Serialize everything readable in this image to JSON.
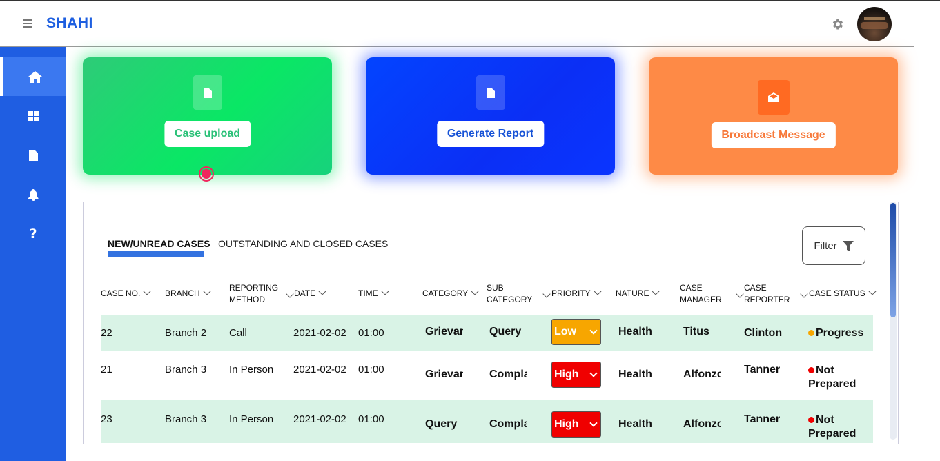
{
  "app": {
    "brand": "SHAHI"
  },
  "colors": {
    "primary": "#1f5ee2",
    "green": "#0ae765",
    "blue": "#0344ff",
    "orange": "#fe8a46",
    "low": "#f7a600",
    "high": "#f00000",
    "row_shade": "#d9f3e6"
  },
  "sidebar": {
    "items": [
      {
        "icon": "home-icon"
      },
      {
        "icon": "dashboard-icon"
      },
      {
        "icon": "document-icon"
      },
      {
        "icon": "bell-icon"
      },
      {
        "icon": "help-icon"
      }
    ]
  },
  "cards": {
    "upload": {
      "label": "Case upload",
      "icon": "file-icon"
    },
    "report": {
      "label": "Generate Report",
      "icon": "file-icon"
    },
    "broadcast": {
      "label": "Broadcast Message",
      "icon": "envelope-open-icon"
    }
  },
  "tabs": [
    {
      "label": "NEW/UNREAD CASES"
    },
    {
      "label": "OUTSTANDING AND CLOSED CASES"
    }
  ],
  "filter": {
    "label": "Filter"
  },
  "columns": {
    "case_no": "CASE NO.",
    "branch": "BRANCH",
    "reporting_1": "REPORTING",
    "reporting_2": "METHOD",
    "date": "DATE",
    "time": "TIME",
    "category": "CATEGORY",
    "sub_1": "SUB",
    "sub_2": "CATEGORY",
    "priority": "PRIORITY",
    "nature": "NATURE",
    "manager_1": "CASE",
    "manager_2": "MANAGER",
    "reporter_1": "CASE",
    "reporter_2": "REPORTER",
    "status": "CASE STATUS"
  },
  "rows": [
    {
      "case_no": "22",
      "branch": "Branch 2",
      "method": "Call",
      "date": "2021-02-02",
      "time": "01:00",
      "category": "Grievance",
      "sub_category": "Query",
      "priority": "Low",
      "nature": "Health",
      "manager": "Titus",
      "reporter": "Clinton",
      "status_1": "Progress",
      "status_2": "",
      "status_color": "#f7a600"
    },
    {
      "case_no": "21",
      "branch": "Branch 3",
      "method": "In Person",
      "date": "2021-02-02",
      "time": "01:00",
      "category": "Grievance",
      "sub_category": "Complaint",
      "priority": "High",
      "nature": "Health",
      "manager": "Alfonzo",
      "reporter": "Tanner",
      "status_1": "Not",
      "status_2": "Prepared",
      "status_color": "#f00000"
    },
    {
      "case_no": "23",
      "branch": "Branch 3",
      "method": "In Person",
      "date": "2021-02-02",
      "time": "01:00",
      "category": "Query",
      "sub_category": "Complaint",
      "priority": "High",
      "nature": "Health",
      "manager": "Alfonzo",
      "reporter": "Tanner",
      "status_1": "Not",
      "status_2": "Prepared",
      "status_color": "#f00000"
    }
  ]
}
